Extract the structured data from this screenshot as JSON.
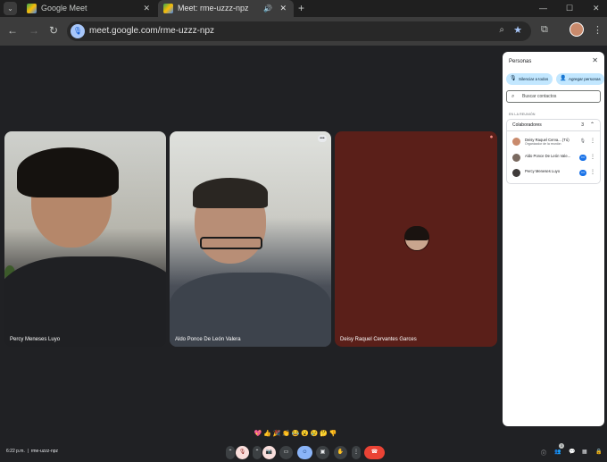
{
  "browser": {
    "tabs": [
      {
        "title": "Google Meet",
        "active": false
      },
      {
        "title": "Meet: rme-uzzz-npz",
        "active": true
      }
    ],
    "url": "meet.google.com/rme-uzzz-npz",
    "icons": {
      "search": "chevron-down-icon",
      "close": "close-icon",
      "new_tab": "plus-icon"
    }
  },
  "tiles": [
    {
      "name": "Percy Meneses Luyo"
    },
    {
      "name": "Aldo Ponce De León Valera"
    },
    {
      "name": "Deisy Raquel Cervantes Garces"
    }
  ],
  "panel": {
    "title": "Personas",
    "mute_all": "Silenciar a todos",
    "add_people": "Agregar personas",
    "search_placeholder": "Buscar contactos",
    "section": "EN LA REUNIÓN",
    "group_label": "Colaboradores",
    "group_count": "3",
    "participants": [
      {
        "name": "Deisy Raquel Cerva...",
        "suffix": "(Tú)",
        "subtitle": "Organizador de la reunión",
        "color": "#c98a6c"
      },
      {
        "name": "Aldo Ponce De León Vale...",
        "suffix": "",
        "subtitle": "",
        "color": "#7a6a60"
      },
      {
        "name": "Percy Meneses Luyo",
        "suffix": "",
        "subtitle": "",
        "color": "#3f3b3a"
      }
    ]
  },
  "reactions": [
    "💖",
    "👍",
    "🎉",
    "👏",
    "😂",
    "😮",
    "😢",
    "🤔",
    "👎"
  ],
  "bottom": {
    "time": "6:22 p.m.",
    "meeting_code": "rme-uzzz-npz",
    "people_count": "3"
  },
  "colors": {
    "accent": "#8ab4f8",
    "end_call": "#ea4335",
    "chip": "#c2e7ff",
    "tile3": "#5a1f19"
  }
}
